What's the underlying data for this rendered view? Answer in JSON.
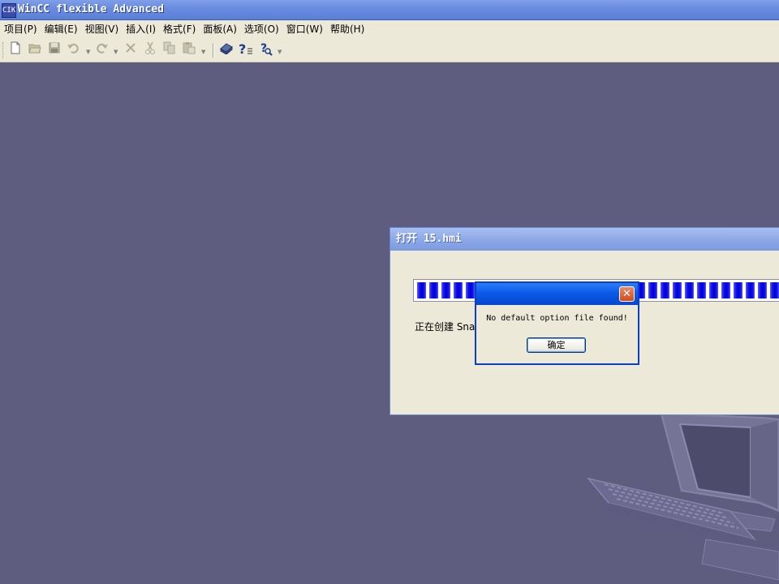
{
  "app": {
    "title": "WinCC flexible Advanced",
    "icon_glyph": "CIK"
  },
  "menu": [
    {
      "label": "项目(P)"
    },
    {
      "label": "编辑(E)"
    },
    {
      "label": "视图(V)"
    },
    {
      "label": "插入(I)"
    },
    {
      "label": "格式(F)"
    },
    {
      "label": "面板(A)"
    },
    {
      "label": "选项(O)"
    },
    {
      "label": "窗口(W)"
    },
    {
      "label": "帮助(H)"
    }
  ],
  "toolbar": {
    "icons": [
      "new-file-icon",
      "open-folder-icon",
      "save-icon",
      "undo-icon",
      "redo-icon",
      "delete-icon",
      "cut-icon",
      "copy-icon",
      "paste-icon",
      "library-icon",
      "help-icon",
      "context-help-icon"
    ]
  },
  "open_dialog": {
    "title": "打开 15.hmi",
    "status": "正在创建 Sna",
    "progress_percent": 100
  },
  "alert": {
    "message": "No default option file found!",
    "ok_label": "确定",
    "close_glyph": "✕"
  },
  "colors": {
    "desktop": "#5f5d7f",
    "xp_blue": "#0d5ae8",
    "dialog_face": "#ece9d8",
    "progress_block": "#1414ee"
  }
}
